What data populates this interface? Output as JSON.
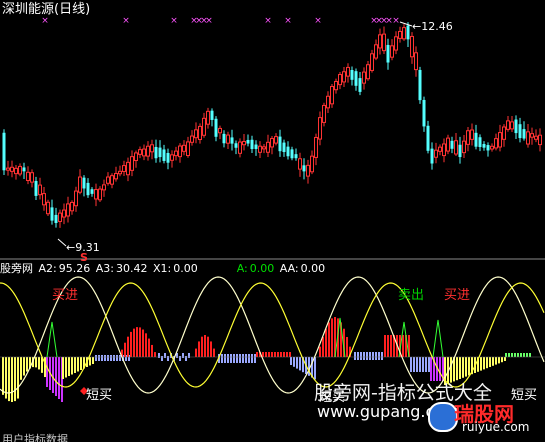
{
  "title": "深圳能源(日线)",
  "price_panel": {
    "high_label": "12.46",
    "low_label": "9.31",
    "signal_mark": "S",
    "marker_glyph": "×",
    "colors": {
      "up": "#ff3333",
      "down": "#54ffff",
      "markers": "#ff55ff",
      "bg": "#000000"
    }
  },
  "indicator_panel": {
    "name": "股旁网",
    "fields": [
      {
        "label": "A2:",
        "value": "95.26",
        "color": "#ffffff"
      },
      {
        "label": "A3:",
        "value": "30.42",
        "color": "#ffffff"
      },
      {
        "label": "X1:",
        "value": "0.00",
        "color": "#ffffff"
      },
      {
        "label": "A:",
        "value": "0.00",
        "color": "#00e000"
      },
      {
        "label": "AA:",
        "value": "0.00",
        "color": "#ffffff"
      }
    ],
    "annotations": {
      "buy_in_left": "买进",
      "sell_out": "卖出",
      "buy_in_right": "买进",
      "short_buy_1": "短买",
      "short_buy_2": "短买",
      "short_buy_3": "短买"
    }
  },
  "watermark": {
    "line1": "股旁网-指标公式大全",
    "line2": "www.gupang.com",
    "brand": "瑞股网",
    "url": "ruiyue.com"
  },
  "bottom_text": "用户指标数据",
  "chart_data": {
    "type": "candlestick",
    "title": "深圳能源(日线)",
    "annotated_high": 12.46,
    "annotated_low": 9.31,
    "indicator_values": {
      "A2": 95.26,
      "A3": 30.42,
      "X1": 0.0,
      "A": 0.0,
      "AA": 0.0
    }
  }
}
